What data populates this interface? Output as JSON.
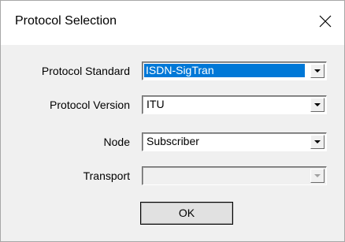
{
  "window": {
    "title": "Protocol Selection",
    "close_icon": "close-x"
  },
  "form": {
    "protocol_standard": {
      "label": "Protocol Standard",
      "value": "ISDN-SigTran"
    },
    "protocol_version": {
      "label": "Protocol Version",
      "value": "ITU"
    },
    "node": {
      "label": "Node",
      "value": "Subscriber"
    },
    "transport": {
      "label": "Transport",
      "value": ""
    }
  },
  "buttons": {
    "ok": "OK"
  },
  "colors": {
    "selection": "#0078d7",
    "dialog_bg": "#f0f0f0"
  }
}
